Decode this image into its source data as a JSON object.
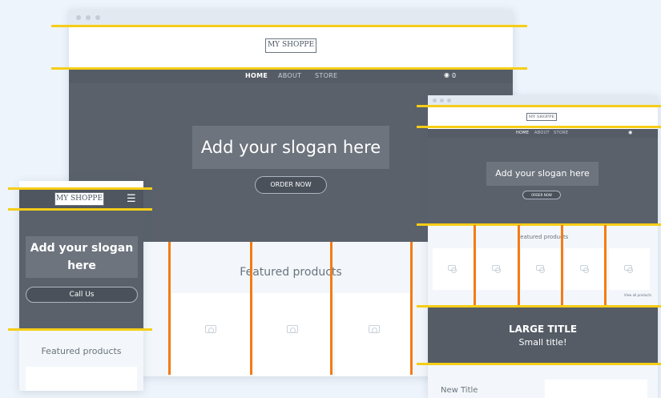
{
  "brand": {
    "logo_text": "MY SHOPPE",
    "logo_small": "MY SHOPPE"
  },
  "nav": {
    "home": "HOME",
    "about": "ABOUT",
    "store": "STORE",
    "cart_count": "0"
  },
  "hero": {
    "slogan": "Add your slogan here",
    "order_button": "ORDER NOW"
  },
  "products": {
    "heading": "Featured products",
    "view_all": "View all products"
  },
  "mobile": {
    "slogan": "Add your slogan here",
    "call_button": "Call Us",
    "products_heading": "Featured products"
  },
  "tablet_extra": {
    "large_title": "LARGE TITLE",
    "small_title": "Small title!",
    "new_title": "New Title"
  },
  "colors": {
    "guide_yellow": "#f6cd17",
    "guide_orange": "#f47b16",
    "hero_dark": "#5a616b"
  }
}
